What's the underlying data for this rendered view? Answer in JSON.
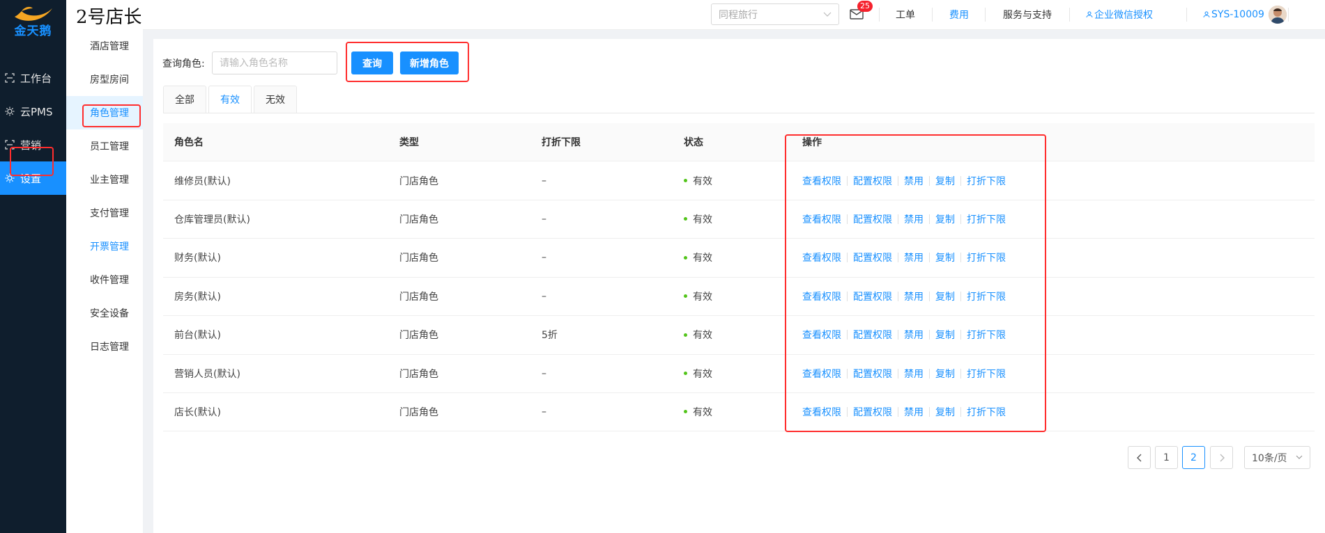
{
  "app": {
    "brand": "金天鹅",
    "store_title": "2号店长"
  },
  "leftnav": [
    {
      "label": "工作台",
      "icon": "workbench-icon"
    },
    {
      "label": "云PMS",
      "icon": "cloud-pms-icon"
    },
    {
      "label": "营销",
      "icon": "marketing-icon"
    },
    {
      "label": "设置",
      "icon": "settings-icon",
      "active": true
    }
  ],
  "topbar": {
    "brand_select": "同程旅行",
    "mail_badge": "25",
    "links": [
      "工单",
      "费用",
      "服务与支持",
      "企业微信授权"
    ],
    "user": "SYS-10009"
  },
  "subnav": [
    "酒店管理",
    "房型房间",
    "角色管理",
    "员工管理",
    "业主管理",
    "支付管理",
    "开票管理",
    "收件管理",
    "安全设备",
    "日志管理"
  ],
  "search": {
    "label": "查询角色:",
    "placeholder": "请输入角色名称",
    "query_btn": "查询",
    "add_btn": "新增角色"
  },
  "tabs": [
    "全部",
    "有效",
    "无效"
  ],
  "table": {
    "headers": [
      "角色名",
      "类型",
      "打折下限",
      "状态",
      "操作"
    ],
    "rows": [
      {
        "name": "维修员(默认)",
        "type": "门店角色",
        "discount": "–",
        "status": "有效"
      },
      {
        "name": "仓库管理员(默认)",
        "type": "门店角色",
        "discount": "–",
        "status": "有效"
      },
      {
        "name": "财务(默认)",
        "type": "门店角色",
        "discount": "–",
        "status": "有效"
      },
      {
        "name": "房务(默认)",
        "type": "门店角色",
        "discount": "–",
        "status": "有效"
      },
      {
        "name": "前台(默认)",
        "type": "门店角色",
        "discount": "5折",
        "status": "有效"
      },
      {
        "name": "营销人员(默认)",
        "type": "门店角色",
        "discount": "–",
        "status": "有效"
      },
      {
        "name": "店长(默认)",
        "type": "门店角色",
        "discount": "–",
        "status": "有效"
      }
    ],
    "actions": [
      "查看权限",
      "配置权限",
      "禁用",
      "复制",
      "打折下限"
    ]
  },
  "pagination": {
    "prev": "<",
    "pages": [
      "1",
      "2"
    ],
    "current": "2",
    "next": ">",
    "page_size": "10条/页"
  },
  "colors": {
    "primary": "#1890ff",
    "sidebar_bg": "#0f1e2d",
    "highlight_box": "#ff2d2d",
    "status_dot": "#52c41a"
  }
}
